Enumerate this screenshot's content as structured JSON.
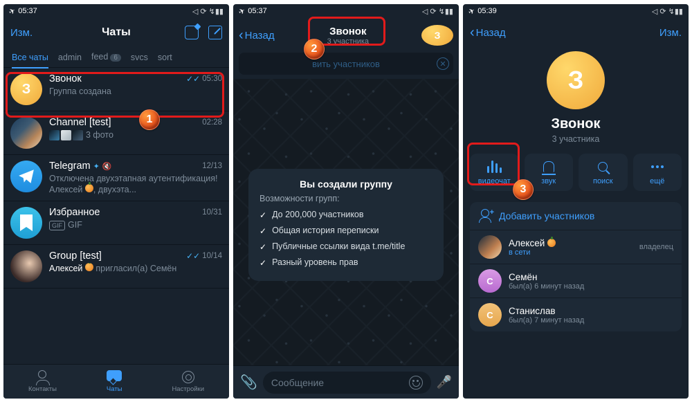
{
  "status_bar": {
    "time1": "05:37",
    "time2": "05:37",
    "time3": "05:39",
    "airplane": "✈",
    "icons_right": "◁ ⟳ ↯▮▮"
  },
  "phone1": {
    "nav": {
      "edit": "Изм.",
      "title": "Чаты"
    },
    "filters": {
      "all": "Все чаты",
      "admin": "admin",
      "feed": "feed",
      "feed_badge": "6",
      "svcs": "svcs",
      "sort": "sort"
    },
    "chats": [
      {
        "title": "Звонок",
        "avatar_initial": "З",
        "sub_sender": "",
        "sub": "Группа создана",
        "time": "05:30",
        "checks": true
      },
      {
        "title": "Channel [test]",
        "sub": "3 фото",
        "time": "02:28",
        "thumbs": true
      },
      {
        "title": "Telegram",
        "verified": true,
        "muted": true,
        "sub": "Отключена двухэтапная аутентификация! Алексей 🍊, двухэта...",
        "time": "12/13"
      },
      {
        "title": "Избранное",
        "sub": "GIF",
        "time": "10/31"
      },
      {
        "title": "Group [test]",
        "sub_sender": "Алексей 🍊",
        "sub": "пригласил(а) Семён",
        "time": "10/14",
        "checks": true
      }
    ],
    "tabs": {
      "contacts": "Контакты",
      "chats": "Чаты",
      "settings": "Настройки"
    }
  },
  "phone2": {
    "back": "Назад",
    "title": "Звонок",
    "subtitle": "3 участника",
    "add_members_hint": "вить участников",
    "bubble": {
      "title": "Вы создали группу",
      "subtitle": "Возможности групп:",
      "items": [
        "До 200,000 участников",
        "Общая история переписки",
        "Публичные ссылки вида t.me/title",
        "Разный уровень прав"
      ]
    },
    "input_placeholder": "Сообщение"
  },
  "phone3": {
    "back": "Назад",
    "edit": "Изм.",
    "avatar_initial": "З",
    "name": "Звонок",
    "subtitle": "3 участника",
    "actions": {
      "videochat": "видеочат",
      "sound": "звук",
      "search": "поиск",
      "more": "ещё"
    },
    "add_members": "Добавить участников",
    "members": [
      {
        "name": "Алексей",
        "emoji": "🍊",
        "status": "в сети",
        "online": true,
        "role": "владелец",
        "avatar": "alex"
      },
      {
        "name": "Семён",
        "status": "был(а) 6 минут назад",
        "online": false,
        "avatar": "c1",
        "initial": "С"
      },
      {
        "name": "Станислав",
        "status": "был(а) 7 минут назад",
        "online": false,
        "avatar": "c2",
        "initial": "С"
      }
    ]
  },
  "markers": {
    "1": "1",
    "2": "2",
    "3": "3"
  }
}
